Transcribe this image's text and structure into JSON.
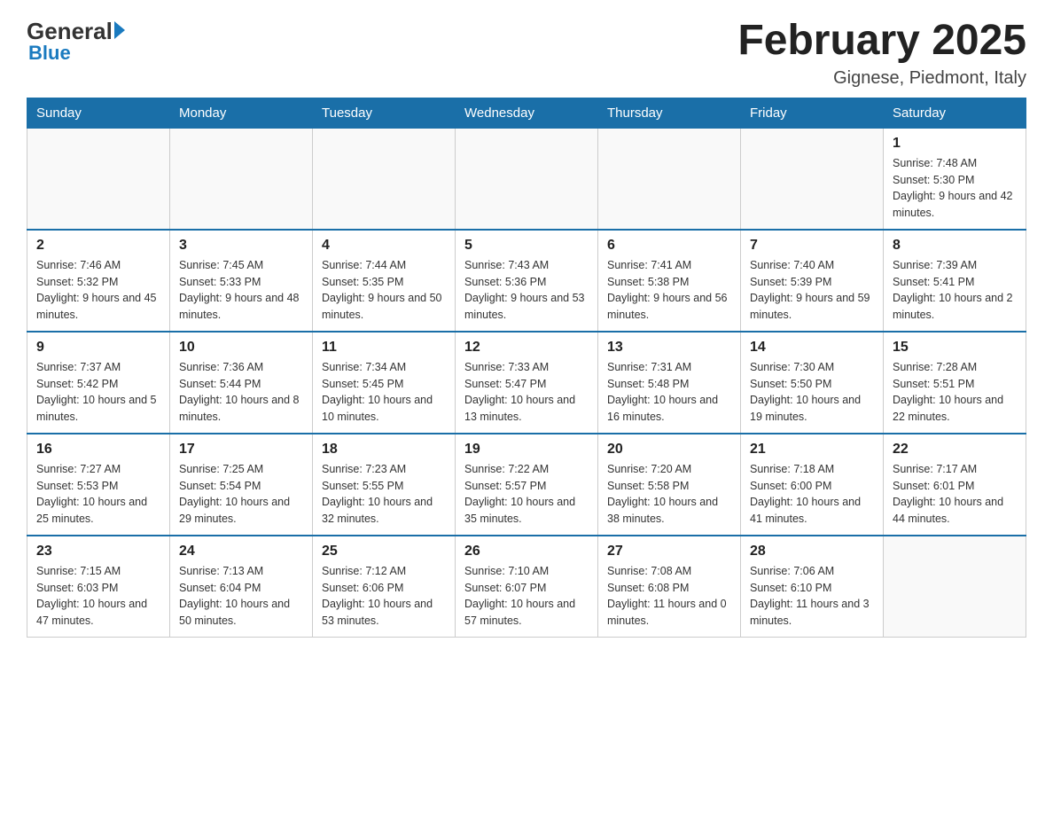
{
  "header": {
    "logo_general": "General",
    "logo_blue": "Blue",
    "title": "February 2025",
    "subtitle": "Gignese, Piedmont, Italy"
  },
  "weekdays": [
    "Sunday",
    "Monday",
    "Tuesday",
    "Wednesday",
    "Thursday",
    "Friday",
    "Saturday"
  ],
  "weeks": [
    [
      {
        "day": "",
        "info": ""
      },
      {
        "day": "",
        "info": ""
      },
      {
        "day": "",
        "info": ""
      },
      {
        "day": "",
        "info": ""
      },
      {
        "day": "",
        "info": ""
      },
      {
        "day": "",
        "info": ""
      },
      {
        "day": "1",
        "info": "Sunrise: 7:48 AM\nSunset: 5:30 PM\nDaylight: 9 hours\nand 42 minutes."
      }
    ],
    [
      {
        "day": "2",
        "info": "Sunrise: 7:46 AM\nSunset: 5:32 PM\nDaylight: 9 hours\nand 45 minutes."
      },
      {
        "day": "3",
        "info": "Sunrise: 7:45 AM\nSunset: 5:33 PM\nDaylight: 9 hours\nand 48 minutes."
      },
      {
        "day": "4",
        "info": "Sunrise: 7:44 AM\nSunset: 5:35 PM\nDaylight: 9 hours\nand 50 minutes."
      },
      {
        "day": "5",
        "info": "Sunrise: 7:43 AM\nSunset: 5:36 PM\nDaylight: 9 hours\nand 53 minutes."
      },
      {
        "day": "6",
        "info": "Sunrise: 7:41 AM\nSunset: 5:38 PM\nDaylight: 9 hours\nand 56 minutes."
      },
      {
        "day": "7",
        "info": "Sunrise: 7:40 AM\nSunset: 5:39 PM\nDaylight: 9 hours\nand 59 minutes."
      },
      {
        "day": "8",
        "info": "Sunrise: 7:39 AM\nSunset: 5:41 PM\nDaylight: 10 hours\nand 2 minutes."
      }
    ],
    [
      {
        "day": "9",
        "info": "Sunrise: 7:37 AM\nSunset: 5:42 PM\nDaylight: 10 hours\nand 5 minutes."
      },
      {
        "day": "10",
        "info": "Sunrise: 7:36 AM\nSunset: 5:44 PM\nDaylight: 10 hours\nand 8 minutes."
      },
      {
        "day": "11",
        "info": "Sunrise: 7:34 AM\nSunset: 5:45 PM\nDaylight: 10 hours\nand 10 minutes."
      },
      {
        "day": "12",
        "info": "Sunrise: 7:33 AM\nSunset: 5:47 PM\nDaylight: 10 hours\nand 13 minutes."
      },
      {
        "day": "13",
        "info": "Sunrise: 7:31 AM\nSunset: 5:48 PM\nDaylight: 10 hours\nand 16 minutes."
      },
      {
        "day": "14",
        "info": "Sunrise: 7:30 AM\nSunset: 5:50 PM\nDaylight: 10 hours\nand 19 minutes."
      },
      {
        "day": "15",
        "info": "Sunrise: 7:28 AM\nSunset: 5:51 PM\nDaylight: 10 hours\nand 22 minutes."
      }
    ],
    [
      {
        "day": "16",
        "info": "Sunrise: 7:27 AM\nSunset: 5:53 PM\nDaylight: 10 hours\nand 25 minutes."
      },
      {
        "day": "17",
        "info": "Sunrise: 7:25 AM\nSunset: 5:54 PM\nDaylight: 10 hours\nand 29 minutes."
      },
      {
        "day": "18",
        "info": "Sunrise: 7:23 AM\nSunset: 5:55 PM\nDaylight: 10 hours\nand 32 minutes."
      },
      {
        "day": "19",
        "info": "Sunrise: 7:22 AM\nSunset: 5:57 PM\nDaylight: 10 hours\nand 35 minutes."
      },
      {
        "day": "20",
        "info": "Sunrise: 7:20 AM\nSunset: 5:58 PM\nDaylight: 10 hours\nand 38 minutes."
      },
      {
        "day": "21",
        "info": "Sunrise: 7:18 AM\nSunset: 6:00 PM\nDaylight: 10 hours\nand 41 minutes."
      },
      {
        "day": "22",
        "info": "Sunrise: 7:17 AM\nSunset: 6:01 PM\nDaylight: 10 hours\nand 44 minutes."
      }
    ],
    [
      {
        "day": "23",
        "info": "Sunrise: 7:15 AM\nSunset: 6:03 PM\nDaylight: 10 hours\nand 47 minutes."
      },
      {
        "day": "24",
        "info": "Sunrise: 7:13 AM\nSunset: 6:04 PM\nDaylight: 10 hours\nand 50 minutes."
      },
      {
        "day": "25",
        "info": "Sunrise: 7:12 AM\nSunset: 6:06 PM\nDaylight: 10 hours\nand 53 minutes."
      },
      {
        "day": "26",
        "info": "Sunrise: 7:10 AM\nSunset: 6:07 PM\nDaylight: 10 hours\nand 57 minutes."
      },
      {
        "day": "27",
        "info": "Sunrise: 7:08 AM\nSunset: 6:08 PM\nDaylight: 11 hours\nand 0 minutes."
      },
      {
        "day": "28",
        "info": "Sunrise: 7:06 AM\nSunset: 6:10 PM\nDaylight: 11 hours\nand 3 minutes."
      },
      {
        "day": "",
        "info": ""
      }
    ]
  ]
}
